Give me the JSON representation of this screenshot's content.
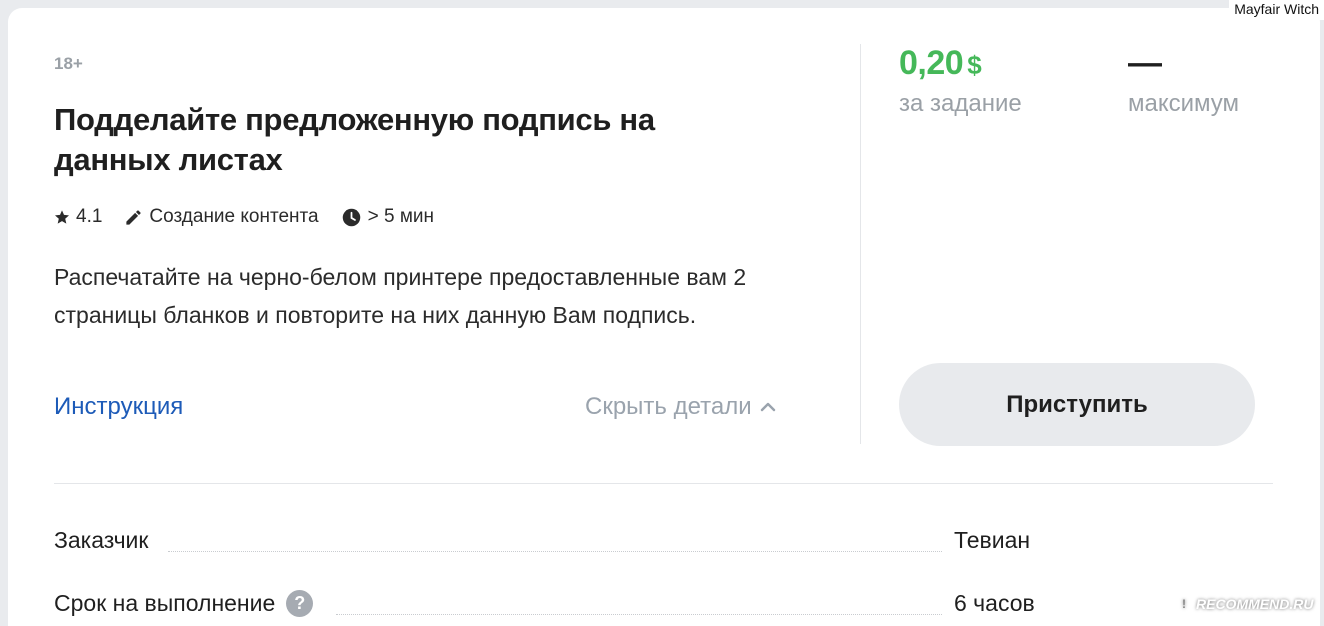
{
  "task": {
    "age_rating": "18+",
    "title": "Подделайте предложенную подпись на данных листах",
    "rating": "4.1",
    "category": "Создание контента",
    "duration": "> 5 мин",
    "description": "Распечатайте на черно-белом принтере предоставленные вам 2 страницы бланков и повторите на них данную Вам подпись.",
    "instruction_link": "Инструкция",
    "toggle_details": "Скрыть детали"
  },
  "reward": {
    "amount": "0,20",
    "currency": "$",
    "caption": "за задание",
    "max_value": "—",
    "max_caption": "максимум"
  },
  "actions": {
    "start_label": "Приступить"
  },
  "details": {
    "rows": [
      {
        "label": "Заказчик",
        "value": "Тевиан",
        "has_help": false
      },
      {
        "label": "Срок на выполнение",
        "value": "6 часов",
        "has_help": true
      }
    ],
    "help_symbol": "?"
  },
  "watermark": {
    "user": "Mayfair Witch",
    "site": "RECOMMEND.RU",
    "site_icon": "!"
  },
  "icons": {
    "rating": "star-icon",
    "category": "pencil-icon",
    "duration": "clock-icon",
    "toggle": "chevron-up-icon"
  },
  "colors": {
    "price": "#45b859",
    "link": "#1d5bb8",
    "muted": "#9aa0a6",
    "button_bg": "#e8eaed"
  }
}
